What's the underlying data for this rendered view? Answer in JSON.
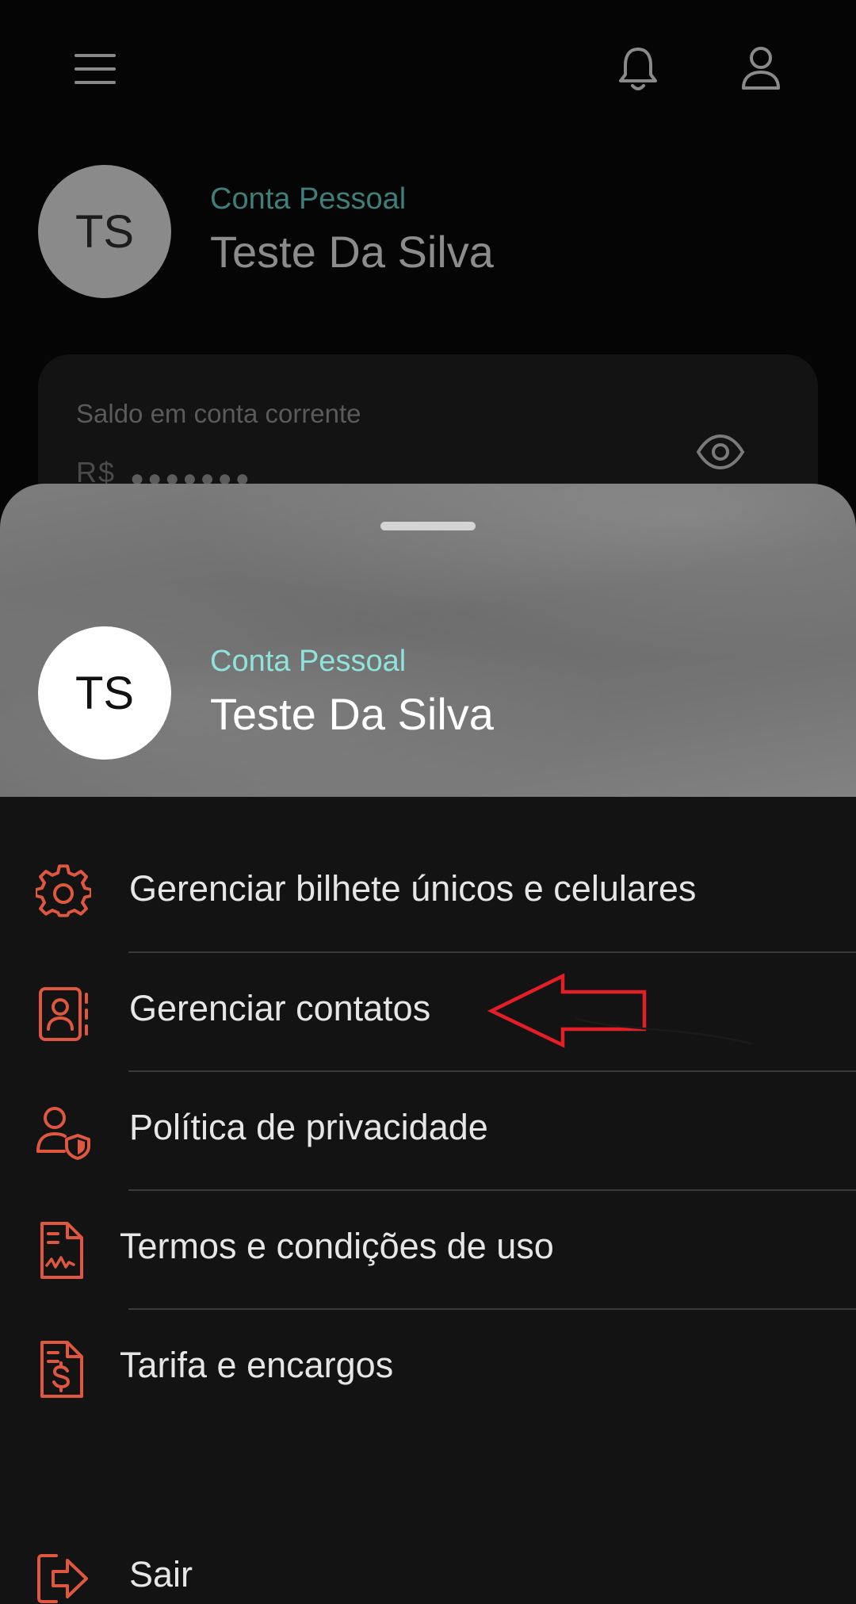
{
  "header": {
    "menu_icon": "hamburger-menu-icon",
    "notification_icon": "bell-icon",
    "profile_icon": "user-icon"
  },
  "profile": {
    "initials": "TS",
    "account_type": "Conta Pessoal",
    "name": "Teste Da Silva"
  },
  "balance": {
    "label": "Saldo em conta corrente",
    "currency": "R$",
    "masked_value": "●●●●●●●",
    "toggle_icon": "eye-icon"
  },
  "sheet": {
    "initials": "TS",
    "account_type": "Conta Pessoal",
    "name": "Teste Da Silva",
    "menu": [
      {
        "label": "Gerenciar bilhete únicos e celulares",
        "icon": "gear-icon"
      },
      {
        "label": "Gerenciar contatos",
        "icon": "contacts-book-icon"
      },
      {
        "label": "Política de privacidade",
        "icon": "user-shield-icon"
      },
      {
        "label": "Termos e condições de uso",
        "icon": "document-icon"
      },
      {
        "label": "Tarifa e encargos",
        "icon": "dollar-document-icon"
      }
    ],
    "logout": {
      "label": "Sair",
      "icon": "logout-icon"
    }
  },
  "colors": {
    "accent": "#e0573f",
    "teal": "#8fe3da",
    "annotation_red": "#e41e26"
  }
}
